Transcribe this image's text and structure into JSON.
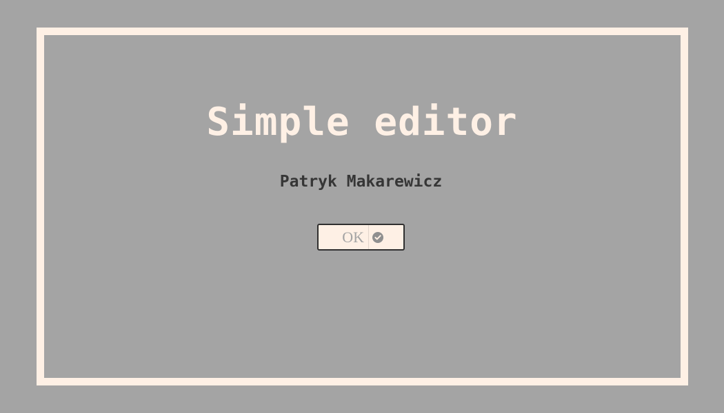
{
  "dialog": {
    "title": "Simple editor",
    "author": "Patryk Makarewicz",
    "ok_label": "OK",
    "ok_icon": "check-circle-icon"
  },
  "colors": {
    "background": "#a4a4a4",
    "frame": "#fef0e5",
    "title": "#fef0e5",
    "author": "#363636",
    "button_background": "#fef0e5",
    "button_border": "#2f2f2f",
    "button_text": "#a4a4a4"
  }
}
